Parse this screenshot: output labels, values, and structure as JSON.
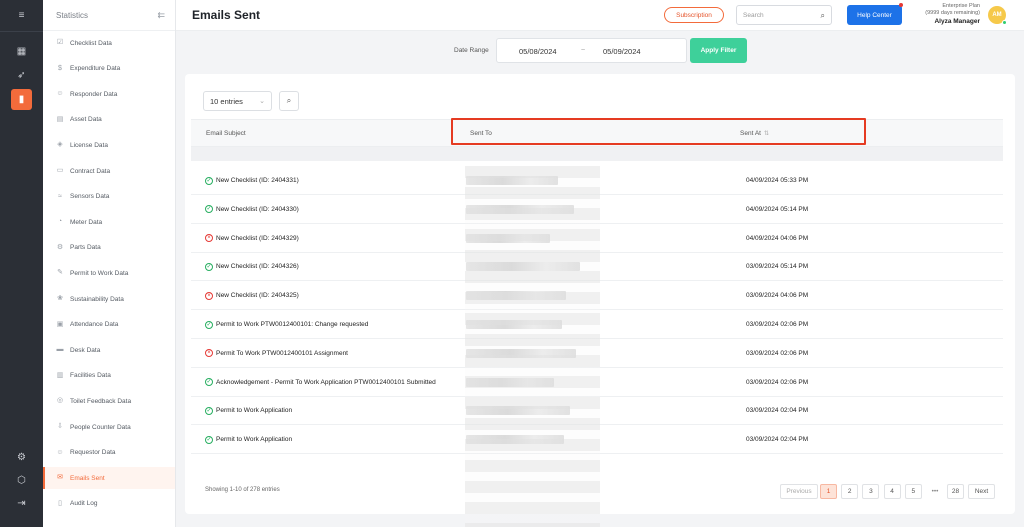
{
  "sidebar": {
    "title": "Statistics",
    "items": [
      {
        "label": "Checklist Data",
        "icon": "checklist-icon"
      },
      {
        "label": "Expenditure Data",
        "icon": "expenditure-icon"
      },
      {
        "label": "Responder Data",
        "icon": "responder-icon"
      },
      {
        "label": "Asset Data",
        "icon": "asset-icon"
      },
      {
        "label": "License Data",
        "icon": "license-icon"
      },
      {
        "label": "Contract Data",
        "icon": "contract-icon"
      },
      {
        "label": "Sensors Data",
        "icon": "sensor-icon"
      },
      {
        "label": "Meter Data",
        "icon": "meter-icon"
      },
      {
        "label": "Parts Data",
        "icon": "parts-icon"
      },
      {
        "label": "Permit to Work Data",
        "icon": "permit-icon"
      },
      {
        "label": "Sustainability Data",
        "icon": "sustainability-icon"
      },
      {
        "label": "Attendance Data",
        "icon": "attendance-icon"
      },
      {
        "label": "Desk Data",
        "icon": "desk-icon"
      },
      {
        "label": "Facilities Data",
        "icon": "facilities-icon"
      },
      {
        "label": "Toilet Feedback Data",
        "icon": "toilet-icon"
      },
      {
        "label": "People Counter Data",
        "icon": "people-counter-icon"
      },
      {
        "label": "Requestor Data",
        "icon": "requestor-icon"
      },
      {
        "label": "Emails Sent",
        "icon": "email-icon",
        "active": true
      },
      {
        "label": "Audit Log",
        "icon": "audit-icon"
      }
    ]
  },
  "header": {
    "title": "Emails Sent",
    "subscription_label": "Subscription",
    "search_placeholder": "Search",
    "help_label": "Help Center",
    "plan_name": "Enterprise Plan",
    "plan_days": "(9999 days remaining)",
    "user_name": "Alyza Manager",
    "avatar_initials": "AM"
  },
  "filter": {
    "label": "Date Range",
    "start": "05/08/2024",
    "separator": "~",
    "end": "05/09/2024",
    "apply_label": "Apply Filter"
  },
  "table": {
    "entries_label": "10 entries",
    "columns": {
      "subject": "Email Subject",
      "sent_to": "Sent To",
      "sent_at": "Sent At"
    },
    "rows": [
      {
        "subject": "New Checklist (ID: 2404331)",
        "status": "success",
        "sent_at": "04/09/2024 05:33 PM"
      },
      {
        "subject": "New Checklist (ID: 2404330)",
        "status": "success",
        "sent_at": "04/09/2024 05:14 PM"
      },
      {
        "subject": "New Checklist (ID: 2404329)",
        "status": "failed",
        "sent_at": "04/09/2024 04:06 PM"
      },
      {
        "subject": "New Checklist (ID: 2404326)",
        "status": "success",
        "sent_at": "03/09/2024 05:14 PM"
      },
      {
        "subject": "New Checklist (ID: 2404325)",
        "status": "failed",
        "sent_at": "03/09/2024 04:06 PM"
      },
      {
        "subject": "Permit to Work PTW0012400101: Change requested",
        "status": "success",
        "sent_at": "03/09/2024 02:06 PM"
      },
      {
        "subject": "Permit To Work PTW0012400101 Assignment",
        "status": "failed",
        "sent_at": "03/09/2024 02:06 PM"
      },
      {
        "subject": "Acknowledgement - Permit To Work Application PTW0012400101 Submitted",
        "status": "success",
        "sent_at": "03/09/2024 02:06 PM"
      },
      {
        "subject": "Permit to Work Application",
        "status": "success",
        "sent_at": "03/09/2024 02:04 PM"
      },
      {
        "subject": "Permit to Work Application",
        "status": "success",
        "sent_at": "03/09/2024 02:04 PM"
      }
    ],
    "footer_info": "Showing 1-10 of 278 entries",
    "pagination": {
      "previous": "Previous",
      "pages": [
        "1",
        "2",
        "3",
        "4",
        "5"
      ],
      "ellipsis": "•••",
      "last": "28",
      "next": "Next",
      "current": "1"
    }
  }
}
